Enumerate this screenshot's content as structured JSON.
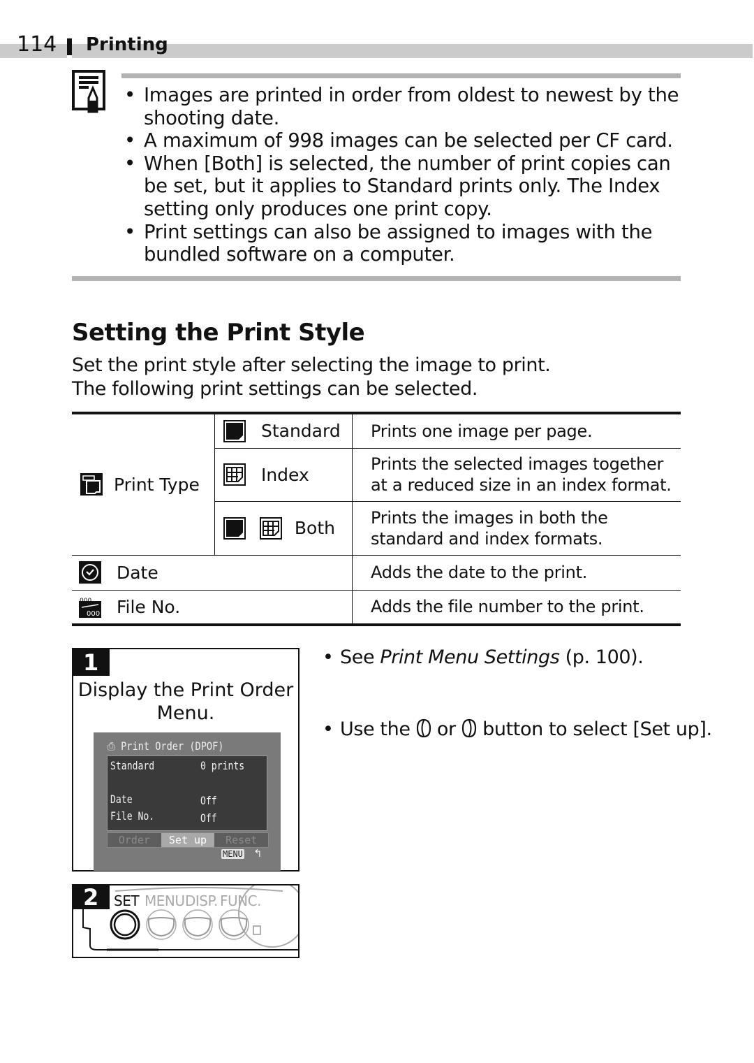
{
  "header": {
    "page_number": "114",
    "section": "Printing"
  },
  "note": {
    "icon": "memo-pencil-icon",
    "items": [
      "Images are printed in order from oldest to newest by the shooting date.",
      "A maximum of 998 images can be selected per CF card.",
      "When [Both] is selected, the number of print copies can be set, but it applies to Standard prints only. The Index setting only produces one print copy.",
      "Print settings can also be assigned to images with the bundled software on a computer."
    ]
  },
  "section": {
    "title": "Setting the Print Style",
    "intro_line1": "Set the print style after selecting the image to print.",
    "intro_line2": "The following print settings can be selected."
  },
  "table": {
    "print_type": {
      "label": "Print Type",
      "icon": "print-type-icon"
    },
    "rows": [
      {
        "option": "Standard",
        "icon": "standard-print-icon",
        "description": "Prints one image per page."
      },
      {
        "option": "Index",
        "icon": "index-print-icon",
        "description": "Prints the selected images together at a reduced size in an index format."
      },
      {
        "option": "Both",
        "icon": "both-print-icon",
        "description": "Prints the images in both the standard and index formats."
      }
    ],
    "date": {
      "label": "Date",
      "icon": "date-icon",
      "description": "Adds the date to the print."
    },
    "file_no": {
      "label": "File No.",
      "icon": "file-number-icon",
      "description": "Adds the file number to the print."
    }
  },
  "steps": [
    {
      "number": "1",
      "text": "Display the Print Order Menu.",
      "screen": {
        "title": "Print Order (DPOF)",
        "rows": [
          {
            "label": "Standard",
            "value": "0 prints"
          },
          {
            "label": "Date",
            "value": "Off"
          },
          {
            "label": "File No.",
            "value": "Off"
          }
        ],
        "tabs": [
          "Order",
          "Set up",
          "Reset"
        ],
        "selected_tab": "Set up",
        "menu_label": "MENU"
      },
      "bullet": {
        "prefix": "See ",
        "italic": "Print Menu Settings",
        "suffix": " (p. 100)."
      }
    },
    {
      "number": "2",
      "buttons": [
        "SET",
        "MENU",
        "DISP.",
        "FUNC."
      ],
      "bullet": {
        "prefix": "Use the",
        "middle": "or",
        "suffix": "button to select [Set up]."
      }
    }
  ]
}
